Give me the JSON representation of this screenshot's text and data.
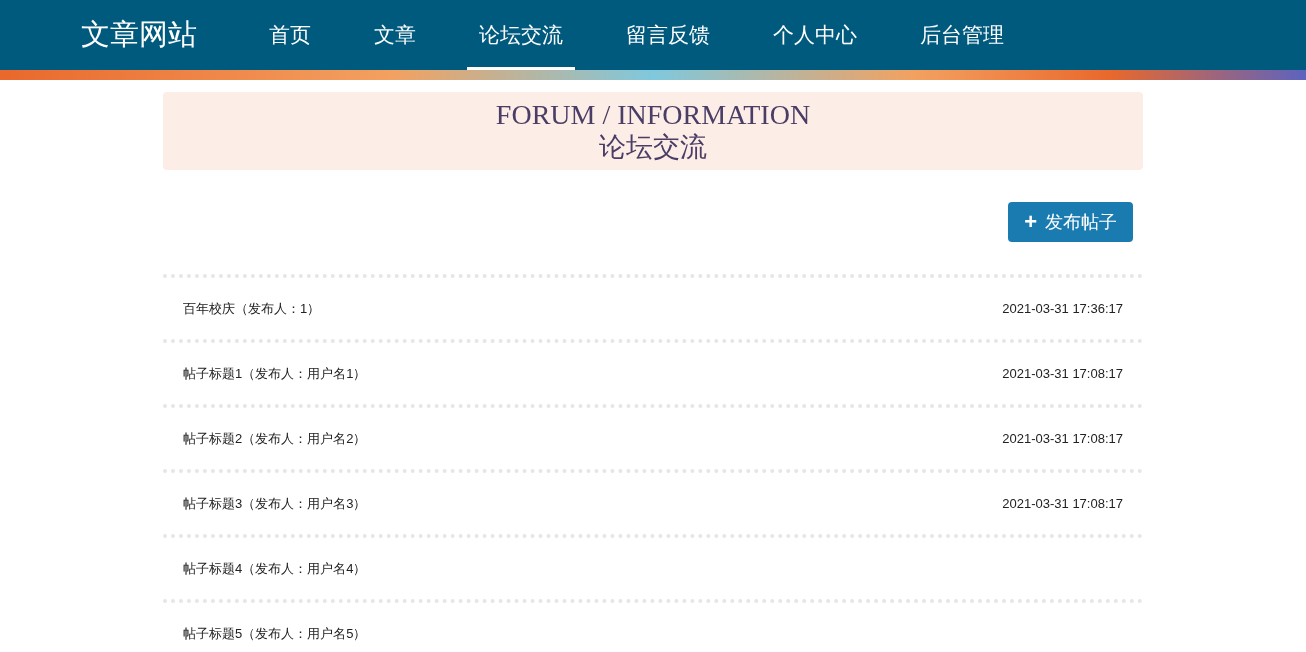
{
  "header": {
    "brand": "文章网站",
    "nav": [
      {
        "label": "首页",
        "selected": false
      },
      {
        "label": "文章",
        "selected": false
      },
      {
        "label": "论坛交流",
        "selected": true
      },
      {
        "label": "留言反馈",
        "selected": false
      },
      {
        "label": "个人中心",
        "selected": false
      },
      {
        "label": "后台管理",
        "selected": false
      }
    ]
  },
  "banner": {
    "title": "FORUM / INFORMATION",
    "subtitle": "论坛交流"
  },
  "publish_button": {
    "icon": "+",
    "label": "发布帖子"
  },
  "posts": [
    {
      "title": "百年校庆（发布人：1）",
      "time": "2021-03-31 17:36:17"
    },
    {
      "title": "帖子标题1（发布人：用户名1）",
      "time": "2021-03-31 17:08:17"
    },
    {
      "title": "帖子标题2（发布人：用户名2）",
      "time": "2021-03-31 17:08:17"
    },
    {
      "title": "帖子标题3（发布人：用户名3）",
      "time": "2021-03-31 17:08:17"
    },
    {
      "title": "帖子标题4（发布人：用户名4）"
    },
    {
      "title": "帖子标题5（发布人：用户名5）"
    }
  ]
}
